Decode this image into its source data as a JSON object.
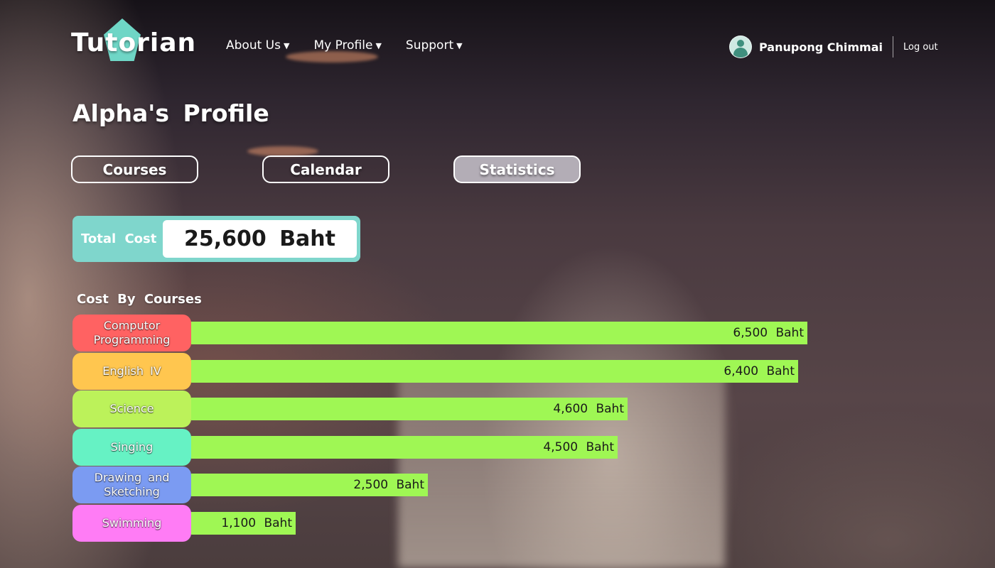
{
  "brand": {
    "logo_text": "Tutorian",
    "accent": "#6fd6c6"
  },
  "nav": [
    {
      "label": "About Us"
    },
    {
      "label": "My Profile"
    },
    {
      "label": "Support"
    }
  ],
  "user": {
    "name": "Panupong Chimmai",
    "logout_label": "Log out"
  },
  "page_title": "Alpha's Profile",
  "tabs": [
    {
      "label": "Courses",
      "active": false
    },
    {
      "label": "Calendar",
      "active": false
    },
    {
      "label": "Statistics",
      "active": true
    }
  ],
  "total": {
    "label": "Total Cost",
    "value": "25,600 Baht"
  },
  "section_label": "Cost By Courses",
  "chart_data": {
    "type": "bar",
    "orientation": "horizontal",
    "unit": "Baht",
    "categories": [
      "Computor Programming",
      "English IV",
      "Science",
      "Singing",
      "Drawing and Sketching",
      "Swimming"
    ],
    "values": [
      6500,
      6400,
      4600,
      4500,
      2500,
      1100
    ],
    "value_labels": [
      "6,500 Baht",
      "6,400 Baht",
      "4,600 Baht",
      "4,500 Baht",
      "2,500 Baht",
      "1,100 Baht"
    ],
    "label_colors": [
      "#ff6262",
      "#ffc64f",
      "#bcf25a",
      "#66f2c4",
      "#7b9bf2",
      "#ff7cf5"
    ],
    "bar_color": "#9ff754"
  }
}
